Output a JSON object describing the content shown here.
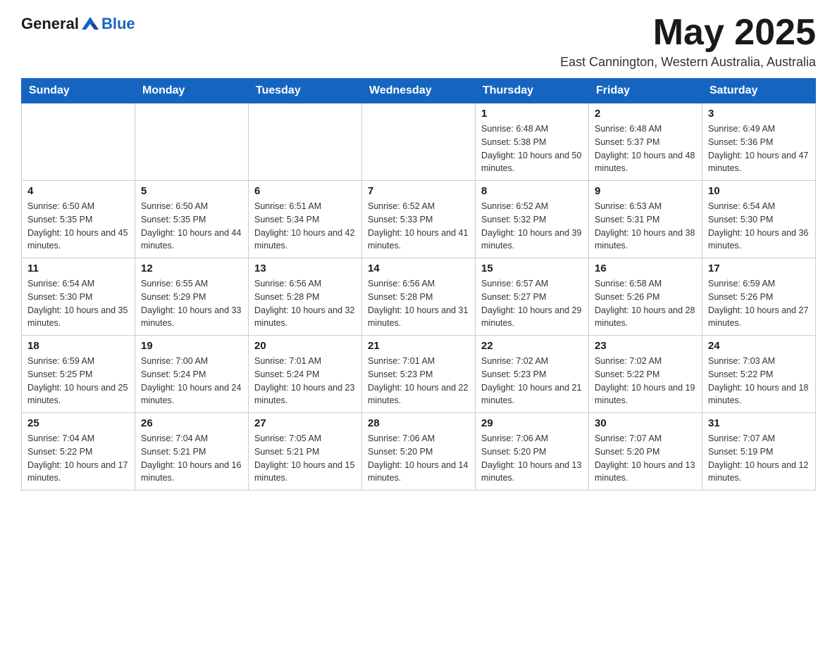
{
  "header": {
    "logo_general": "General",
    "logo_blue": "Blue",
    "month_title": "May 2025",
    "location": "East Cannington, Western Australia, Australia"
  },
  "weekdays": [
    "Sunday",
    "Monday",
    "Tuesday",
    "Wednesday",
    "Thursday",
    "Friday",
    "Saturday"
  ],
  "weeks": [
    [
      {
        "day": "",
        "sunrise": "",
        "sunset": "",
        "daylight": ""
      },
      {
        "day": "",
        "sunrise": "",
        "sunset": "",
        "daylight": ""
      },
      {
        "day": "",
        "sunrise": "",
        "sunset": "",
        "daylight": ""
      },
      {
        "day": "",
        "sunrise": "",
        "sunset": "",
        "daylight": ""
      },
      {
        "day": "1",
        "sunrise": "Sunrise: 6:48 AM",
        "sunset": "Sunset: 5:38 PM",
        "daylight": "Daylight: 10 hours and 50 minutes."
      },
      {
        "day": "2",
        "sunrise": "Sunrise: 6:48 AM",
        "sunset": "Sunset: 5:37 PM",
        "daylight": "Daylight: 10 hours and 48 minutes."
      },
      {
        "day": "3",
        "sunrise": "Sunrise: 6:49 AM",
        "sunset": "Sunset: 5:36 PM",
        "daylight": "Daylight: 10 hours and 47 minutes."
      }
    ],
    [
      {
        "day": "4",
        "sunrise": "Sunrise: 6:50 AM",
        "sunset": "Sunset: 5:35 PM",
        "daylight": "Daylight: 10 hours and 45 minutes."
      },
      {
        "day": "5",
        "sunrise": "Sunrise: 6:50 AM",
        "sunset": "Sunset: 5:35 PM",
        "daylight": "Daylight: 10 hours and 44 minutes."
      },
      {
        "day": "6",
        "sunrise": "Sunrise: 6:51 AM",
        "sunset": "Sunset: 5:34 PM",
        "daylight": "Daylight: 10 hours and 42 minutes."
      },
      {
        "day": "7",
        "sunrise": "Sunrise: 6:52 AM",
        "sunset": "Sunset: 5:33 PM",
        "daylight": "Daylight: 10 hours and 41 minutes."
      },
      {
        "day": "8",
        "sunrise": "Sunrise: 6:52 AM",
        "sunset": "Sunset: 5:32 PM",
        "daylight": "Daylight: 10 hours and 39 minutes."
      },
      {
        "day": "9",
        "sunrise": "Sunrise: 6:53 AM",
        "sunset": "Sunset: 5:31 PM",
        "daylight": "Daylight: 10 hours and 38 minutes."
      },
      {
        "day": "10",
        "sunrise": "Sunrise: 6:54 AM",
        "sunset": "Sunset: 5:30 PM",
        "daylight": "Daylight: 10 hours and 36 minutes."
      }
    ],
    [
      {
        "day": "11",
        "sunrise": "Sunrise: 6:54 AM",
        "sunset": "Sunset: 5:30 PM",
        "daylight": "Daylight: 10 hours and 35 minutes."
      },
      {
        "day": "12",
        "sunrise": "Sunrise: 6:55 AM",
        "sunset": "Sunset: 5:29 PM",
        "daylight": "Daylight: 10 hours and 33 minutes."
      },
      {
        "day": "13",
        "sunrise": "Sunrise: 6:56 AM",
        "sunset": "Sunset: 5:28 PM",
        "daylight": "Daylight: 10 hours and 32 minutes."
      },
      {
        "day": "14",
        "sunrise": "Sunrise: 6:56 AM",
        "sunset": "Sunset: 5:28 PM",
        "daylight": "Daylight: 10 hours and 31 minutes."
      },
      {
        "day": "15",
        "sunrise": "Sunrise: 6:57 AM",
        "sunset": "Sunset: 5:27 PM",
        "daylight": "Daylight: 10 hours and 29 minutes."
      },
      {
        "day": "16",
        "sunrise": "Sunrise: 6:58 AM",
        "sunset": "Sunset: 5:26 PM",
        "daylight": "Daylight: 10 hours and 28 minutes."
      },
      {
        "day": "17",
        "sunrise": "Sunrise: 6:59 AM",
        "sunset": "Sunset: 5:26 PM",
        "daylight": "Daylight: 10 hours and 27 minutes."
      }
    ],
    [
      {
        "day": "18",
        "sunrise": "Sunrise: 6:59 AM",
        "sunset": "Sunset: 5:25 PM",
        "daylight": "Daylight: 10 hours and 25 minutes."
      },
      {
        "day": "19",
        "sunrise": "Sunrise: 7:00 AM",
        "sunset": "Sunset: 5:24 PM",
        "daylight": "Daylight: 10 hours and 24 minutes."
      },
      {
        "day": "20",
        "sunrise": "Sunrise: 7:01 AM",
        "sunset": "Sunset: 5:24 PM",
        "daylight": "Daylight: 10 hours and 23 minutes."
      },
      {
        "day": "21",
        "sunrise": "Sunrise: 7:01 AM",
        "sunset": "Sunset: 5:23 PM",
        "daylight": "Daylight: 10 hours and 22 minutes."
      },
      {
        "day": "22",
        "sunrise": "Sunrise: 7:02 AM",
        "sunset": "Sunset: 5:23 PM",
        "daylight": "Daylight: 10 hours and 21 minutes."
      },
      {
        "day": "23",
        "sunrise": "Sunrise: 7:02 AM",
        "sunset": "Sunset: 5:22 PM",
        "daylight": "Daylight: 10 hours and 19 minutes."
      },
      {
        "day": "24",
        "sunrise": "Sunrise: 7:03 AM",
        "sunset": "Sunset: 5:22 PM",
        "daylight": "Daylight: 10 hours and 18 minutes."
      }
    ],
    [
      {
        "day": "25",
        "sunrise": "Sunrise: 7:04 AM",
        "sunset": "Sunset: 5:22 PM",
        "daylight": "Daylight: 10 hours and 17 minutes."
      },
      {
        "day": "26",
        "sunrise": "Sunrise: 7:04 AM",
        "sunset": "Sunset: 5:21 PM",
        "daylight": "Daylight: 10 hours and 16 minutes."
      },
      {
        "day": "27",
        "sunrise": "Sunrise: 7:05 AM",
        "sunset": "Sunset: 5:21 PM",
        "daylight": "Daylight: 10 hours and 15 minutes."
      },
      {
        "day": "28",
        "sunrise": "Sunrise: 7:06 AM",
        "sunset": "Sunset: 5:20 PM",
        "daylight": "Daylight: 10 hours and 14 minutes."
      },
      {
        "day": "29",
        "sunrise": "Sunrise: 7:06 AM",
        "sunset": "Sunset: 5:20 PM",
        "daylight": "Daylight: 10 hours and 13 minutes."
      },
      {
        "day": "30",
        "sunrise": "Sunrise: 7:07 AM",
        "sunset": "Sunset: 5:20 PM",
        "daylight": "Daylight: 10 hours and 13 minutes."
      },
      {
        "day": "31",
        "sunrise": "Sunrise: 7:07 AM",
        "sunset": "Sunset: 5:19 PM",
        "daylight": "Daylight: 10 hours and 12 minutes."
      }
    ]
  ]
}
